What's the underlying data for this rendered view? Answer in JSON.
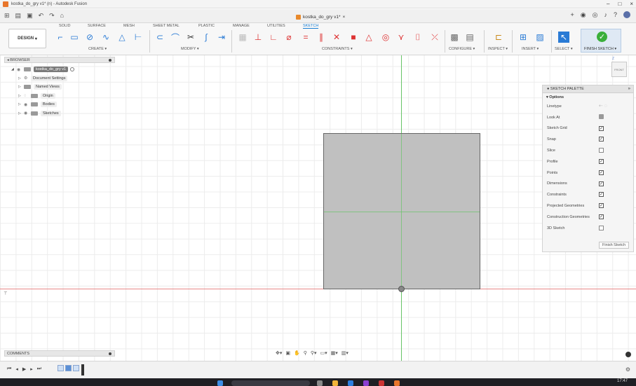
{
  "window": {
    "title": "kostka_do_gry v1* (n) - Autodesk Fusion"
  },
  "document_tab": {
    "label": "kostka_do_gry v1*"
  },
  "ribbon": {
    "tabs": [
      "SOLID",
      "SURFACE",
      "MESH",
      "SHEET METAL",
      "PLASTIC",
      "MANAGE",
      "UTILITIES",
      "SKETCH"
    ],
    "active_tab": "SKETCH",
    "design_label": "DESIGN",
    "groups": {
      "create": "CREATE",
      "modify": "MODIFY",
      "constraints": "CONSTRAINTS",
      "configure": "CONFIGURE",
      "inspect": "INSPECT",
      "insert": "INSERT",
      "select": "SELECT",
      "finish": "FINISH SKETCH"
    }
  },
  "browser": {
    "title": "BROWSER",
    "items": [
      {
        "label": "kostka_do_gry v1"
      },
      {
        "label": "Document Settings"
      },
      {
        "label": "Named Views"
      },
      {
        "label": "Origin"
      },
      {
        "label": "Bodies"
      },
      {
        "label": "Sketches"
      }
    ]
  },
  "palette": {
    "title": "SKETCH PALETTE",
    "section": "Options",
    "options": [
      {
        "label": "Linetype"
      },
      {
        "label": "Look At"
      },
      {
        "label": "Sketch Grid",
        "checked": true
      },
      {
        "label": "Snap",
        "checked": true
      },
      {
        "label": "Slice",
        "checked": false
      },
      {
        "label": "Profile",
        "checked": true
      },
      {
        "label": "Points",
        "checked": true
      },
      {
        "label": "Dimensions",
        "checked": true
      },
      {
        "label": "Constraints",
        "checked": true
      },
      {
        "label": "Projected Geometries",
        "checked": true
      },
      {
        "label": "Construction Geometries",
        "checked": true
      },
      {
        "label": "3D Sketch",
        "checked": false
      }
    ],
    "finish_button": "Finish Sketch"
  },
  "viewcube": {
    "face": "FRONT",
    "axis": "Z"
  },
  "comments": {
    "title": "COMMENTS"
  },
  "taskbar": {
    "time": "17:47"
  },
  "colors": {
    "accent": "#1a7fd4",
    "finish_green": "#3aaf3a",
    "axis_x": "#e88888",
    "axis_y": "#68c468"
  }
}
